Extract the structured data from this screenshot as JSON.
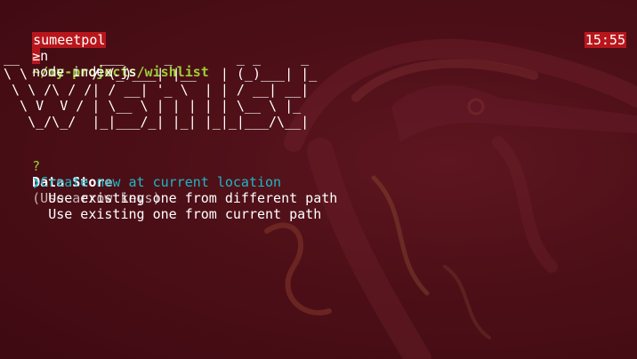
{
  "prompt": {
    "user": "sumeetpol",
    "in_word": "in",
    "path": "~/my-projects/wishlist",
    "symbol": "≥",
    "command": "node index.js",
    "clock": "15:55"
  },
  "banner": {
    "ascii_lines": [
      "__          ___     _        _ _     _   ",
      "\\ \\        / (_)___| |__   | (_)___| |_ ",
      " \\ \\ /\\ / /| / __| '_ \\  | | / __| __|",
      "  \\ V  V / | \\__ \\ | | | | | \\__ \\ |_ ",
      "   \\_/\\_/  |_|___/_| |_| |_|_|___/\\__|"
    ]
  },
  "question": {
    "mark": "?",
    "label": "Data Store",
    "hint": "(Use arrow keys)"
  },
  "options": {
    "pointer": "❯",
    "items": [
      "Create new at current location",
      "Use existing one from different path",
      "Use existing one from current path"
    ]
  },
  "colors": {
    "background": "#4a0e15",
    "highlight": "#b8161b",
    "path_green": "#9ccf3a",
    "selected_cyan": "#1fb6c6"
  }
}
